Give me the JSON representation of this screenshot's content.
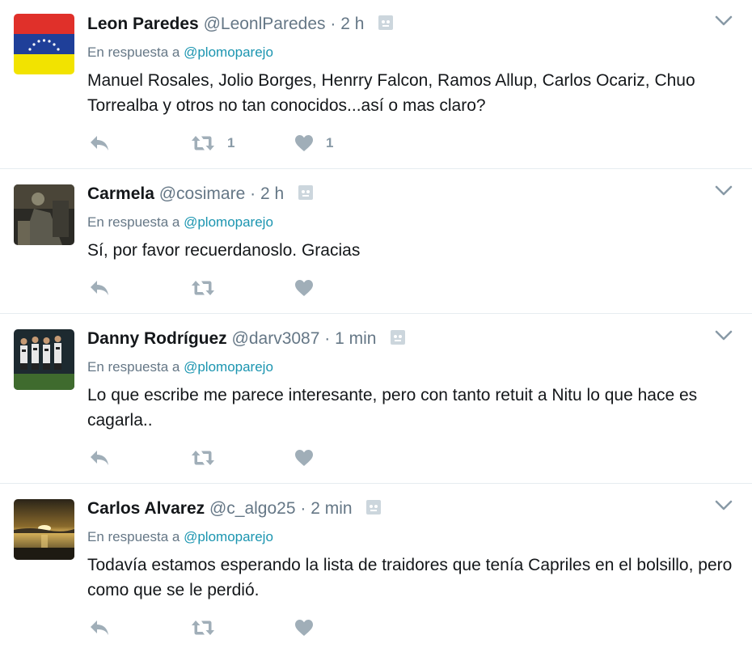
{
  "tweets": [
    {
      "name": "Leon Paredes",
      "handle": "@LeonlParedes",
      "sep": "·",
      "time": "2 h",
      "reply_prefix": "En respuesta a",
      "reply_handle": "@plomoparejo",
      "text": "Manuel Rosales, Jolio Borges, Henrry Falcon, Ramos Allup, Carlos Ocariz, Chuo Torrealba y otros no tan conocidos...así o mas claro?",
      "retweets": "1",
      "likes": "1",
      "avatar": "venezuela-flag"
    },
    {
      "name": "Carmela",
      "handle": "@cosimare",
      "sep": "·",
      "time": "2 h",
      "reply_prefix": "En respuesta a",
      "reply_handle": "@plomoparejo",
      "text": "Sí, por favor recuerdanoslo. Gracias",
      "retweets": "",
      "likes": "",
      "avatar": "photo-dark"
    },
    {
      "name": "Danny Rodríguez",
      "handle": "@darv3087",
      "sep": "·",
      "time": "1 min",
      "reply_prefix": "En respuesta a",
      "reply_handle": "@plomoparejo",
      "text": "Lo que escribe me parece interesante, pero con tanto retuit a Nitu lo que hace es cagarla..",
      "retweets": "",
      "likes": "",
      "avatar": "photo-team"
    },
    {
      "name": "Carlos Alvarez",
      "handle": "@c_algo25",
      "sep": "·",
      "time": "2 min",
      "reply_prefix": "En respuesta a",
      "reply_handle": "@plomoparejo",
      "text": "Todavía estamos esperando la lista de traidores que tenía Capriles en el bolsillo, pero como que se le perdió.",
      "retweets": "",
      "likes": "",
      "avatar": "photo-sunset"
    }
  ],
  "colors": {
    "name": "#14171a",
    "muted": "#657786",
    "link": "#1b95b0",
    "icon": "#8899a6",
    "divider": "#e6ecf0"
  }
}
